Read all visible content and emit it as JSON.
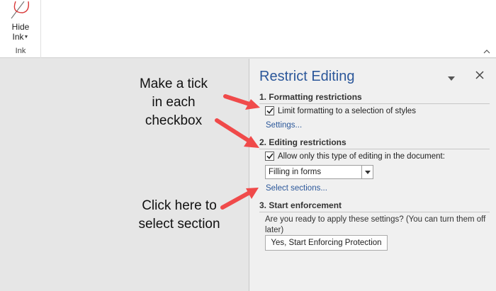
{
  "ribbon": {
    "hide_ink_line1": "Hide",
    "hide_ink_line2": "Ink",
    "group_label": "Ink"
  },
  "annotations": {
    "note1_line1": "Make a tick",
    "note1_line2": "in each",
    "note1_line3": "checkbox",
    "note2_line1": "Click here to",
    "note2_line2": "select section",
    "arrow_color": "#f04a4a"
  },
  "pane": {
    "title": "Restrict Editing",
    "sections": {
      "formatting": {
        "heading": "1. Formatting restrictions",
        "checkbox_label": "Limit formatting to a selection of styles",
        "checked": true,
        "link": "Settings..."
      },
      "editing": {
        "heading": "2. Editing restrictions",
        "checkbox_label": "Allow only this type of editing in the document:",
        "checked": true,
        "select_value": "Filling in forms",
        "link": "Select sections..."
      },
      "enforcement": {
        "heading": "3. Start enforcement",
        "text": "Are you ready to apply these settings? (You can turn them off later)",
        "button": "Yes, Start Enforcing Protection"
      }
    }
  },
  "colors": {
    "accent": "#2b579a",
    "pane_bg": "#f0f0f0",
    "doc_bg": "#e6e6e6"
  }
}
